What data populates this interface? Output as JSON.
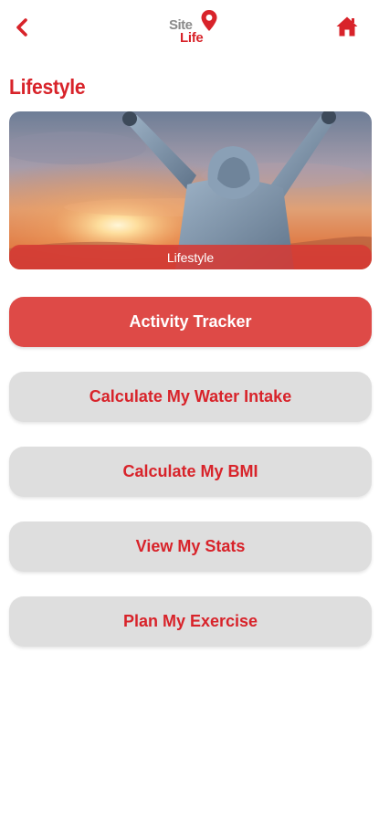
{
  "header": {
    "logo_top": "Site",
    "logo_bottom": "Life"
  },
  "page": {
    "title": "Lifestyle"
  },
  "banner": {
    "caption": "Lifestyle"
  },
  "menu": {
    "items": [
      {
        "label": "Activity Tracker",
        "active": true
      },
      {
        "label": "Calculate My Water Intake",
        "active": false
      },
      {
        "label": "Calculate My BMI",
        "active": false
      },
      {
        "label": "View My Stats",
        "active": false
      },
      {
        "label": "Plan My Exercise",
        "active": false
      }
    ]
  },
  "colors": {
    "brand_red": "#d8232a",
    "active_button": "#de4a47",
    "inactive_button": "#dedede"
  },
  "icons": {
    "back": "chevron-left-icon",
    "home": "home-icon",
    "logo_pin": "map-pin-icon"
  }
}
